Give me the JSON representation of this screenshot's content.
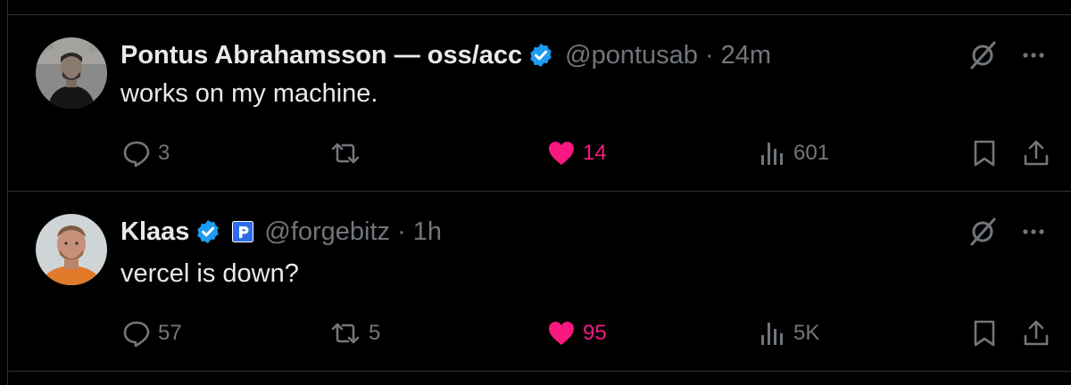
{
  "tweets": [
    {
      "author": "Pontus Abrahamsson — oss/acc",
      "handle": "@pontusab",
      "sep": "·",
      "time": "24m",
      "text": "works on my machine.",
      "replies": "3",
      "reposts": "",
      "likes": "14",
      "views": "601",
      "liked": true
    },
    {
      "author": "Klaas",
      "handle": "@forgebitz",
      "sep": "·",
      "time": "1h",
      "text": "vercel is down?",
      "replies": "57",
      "reposts": "5",
      "likes": "95",
      "views": "5K",
      "liked": true
    }
  ],
  "colors": {
    "background": "#000000",
    "text": "#e7e9ea",
    "muted": "#71767b",
    "verified": "#1d9bf0",
    "like": "#f91880",
    "divider": "#2f3336"
  },
  "icons": [
    "reply-icon",
    "repost-icon",
    "heart-icon",
    "views-icon",
    "bookmark-icon",
    "share-icon",
    "grok-icon",
    "more-icon",
    "verified-badge-icon",
    "affiliate-badge-icon"
  ]
}
